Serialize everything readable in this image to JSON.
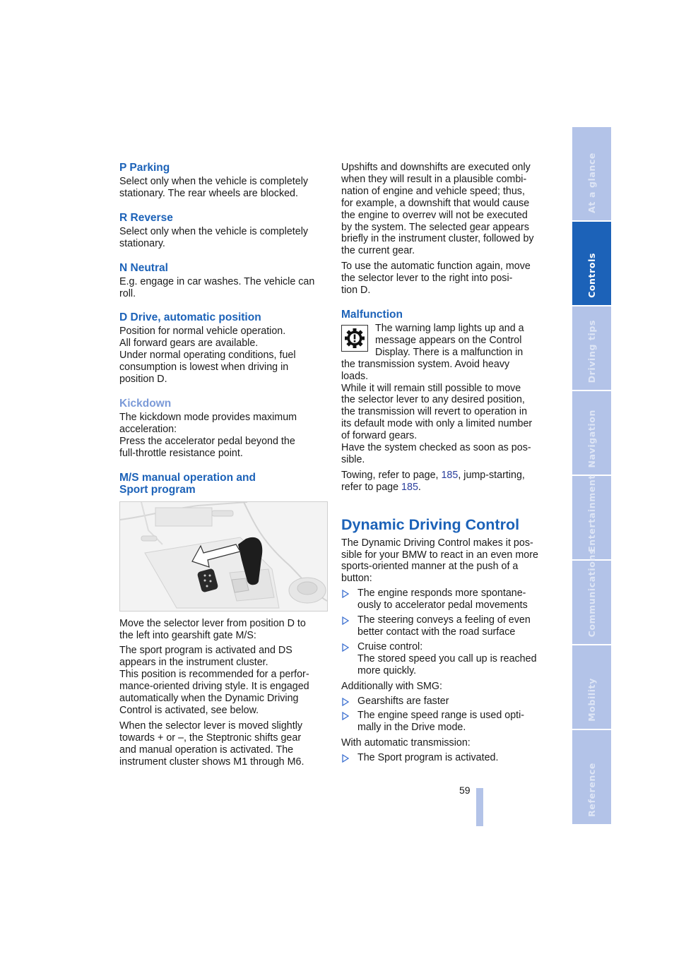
{
  "left_column": {
    "p_parking": {
      "heading": "P Parking",
      "text": [
        "Select only when the vehicle is completely",
        "stationary. The rear wheels are blocked."
      ]
    },
    "r_reverse": {
      "heading": "R Reverse",
      "text": [
        "Select only when the vehicle is completely",
        "stationary."
      ]
    },
    "n_neutral": {
      "heading": "N Neutral",
      "text": [
        "E.g. engage in car washes. The vehicle can",
        "roll."
      ]
    },
    "d_drive": {
      "heading": "D Drive, automatic position",
      "text": [
        "Position for normal vehicle operation.",
        "All forward gears are available.",
        "Under normal operating conditions, fuel",
        "consumption is lowest when driving in",
        "position D."
      ]
    },
    "kickdown": {
      "heading": "Kickdown",
      "text": [
        "The kickdown mode provides maximum",
        "acceleration:",
        "Press the accelerator pedal beyond the",
        "full-throttle resistance point."
      ]
    },
    "ms_manual": {
      "heading_line1": "M/S manual operation and",
      "heading_line2": "Sport program",
      "figure_alt": "Selector lever moved left into gearshift gate M/S",
      "para1": [
        "Move the selector lever from position D to",
        "the left into gearshift gate M/S:"
      ],
      "para2": [
        "The sport program is activated and DS",
        "appears in the instrument cluster.",
        "This position is recommended for a perfor-",
        "mance-oriented driving style. It is engaged",
        "automatically when the Dynamic Driving",
        "Control is activated, see below."
      ],
      "para3": [
        "When the selector lever is moved slightly",
        "towards + or –, the Steptronic shifts gear",
        "and manual operation is activated. The",
        "instrument cluster shows M1 through M6."
      ]
    }
  },
  "right_column": {
    "shifts": {
      "para1": [
        "Upshifts and downshifts are executed only",
        "when they will result in a plausible combi-",
        "nation of engine and vehicle speed; thus,",
        "for example, a downshift that would cause",
        "the engine to overrev will not be executed",
        "by the system. The selected gear appears",
        "briefly in the instrument cluster, followed by",
        "the current gear."
      ],
      "para2": [
        "To use the automatic function again, move",
        "the selector lever to the right into posi-",
        "tion D."
      ]
    },
    "malfunction": {
      "heading": "Malfunction",
      "icon": "transmission-warning-gear-icon",
      "text": [
        "The warning lamp lights up and a",
        "message appears on the Control",
        "Display. There is a malfunction in",
        "the transmission system. Avoid heavy",
        "loads.",
        "While it will remain still possible to move",
        "the selector lever to any desired position,",
        "the transmission will revert to operation in",
        "its default mode with only a limited number",
        "of forward gears.",
        "Have the system checked as soon as pos-",
        "sible."
      ],
      "towing_prefix": "Towing, refer to page, ",
      "towing_page": "185",
      "towing_mid": ", jump-starting,",
      "towing_line2_prefix": "refer to page ",
      "jump_page": "185",
      "towing_suffix": "."
    },
    "ddc": {
      "heading": "Dynamic Driving Control",
      "intro": [
        "The Dynamic Driving Control makes it pos-",
        "sible for your BMW to react in an even more",
        "sports-oriented manner at the push of a",
        "button:"
      ],
      "bullets": [
        [
          "The engine responds more spontane-",
          "ously to accelerator pedal movements"
        ],
        [
          "The steering conveys a feeling of even",
          "better contact with the road surface"
        ],
        [
          "Cruise control:",
          "The stored speed you call up is reached",
          "more quickly."
        ]
      ],
      "smg_label": "Additionally with SMG:",
      "smg_bullets": [
        [
          "Gearshifts are faster"
        ],
        [
          "The engine speed range is used opti-",
          "mally in the Drive mode."
        ]
      ],
      "auto_label": "With automatic transmission:",
      "auto_bullets": [
        [
          "The Sport program is activated."
        ]
      ]
    }
  },
  "page_number": "59",
  "side_tabs": [
    {
      "label": "At a glance",
      "active": false
    },
    {
      "label": "Controls",
      "active": true
    },
    {
      "label": "Driving tips",
      "active": false
    },
    {
      "label": "Navigation",
      "active": false
    },
    {
      "label": "Entertainment",
      "active": false
    },
    {
      "label": "Communications",
      "active": false
    },
    {
      "label": "Mobility",
      "active": false
    },
    {
      "label": "Reference",
      "active": false
    }
  ],
  "colors": {
    "heading_blue": "#1c62b8",
    "subheading_light_blue": "#7b9ad8",
    "link_blue": "#2a3f9d",
    "tab_inactive": "#b3c3e8",
    "tab_active": "#1c62b8"
  }
}
